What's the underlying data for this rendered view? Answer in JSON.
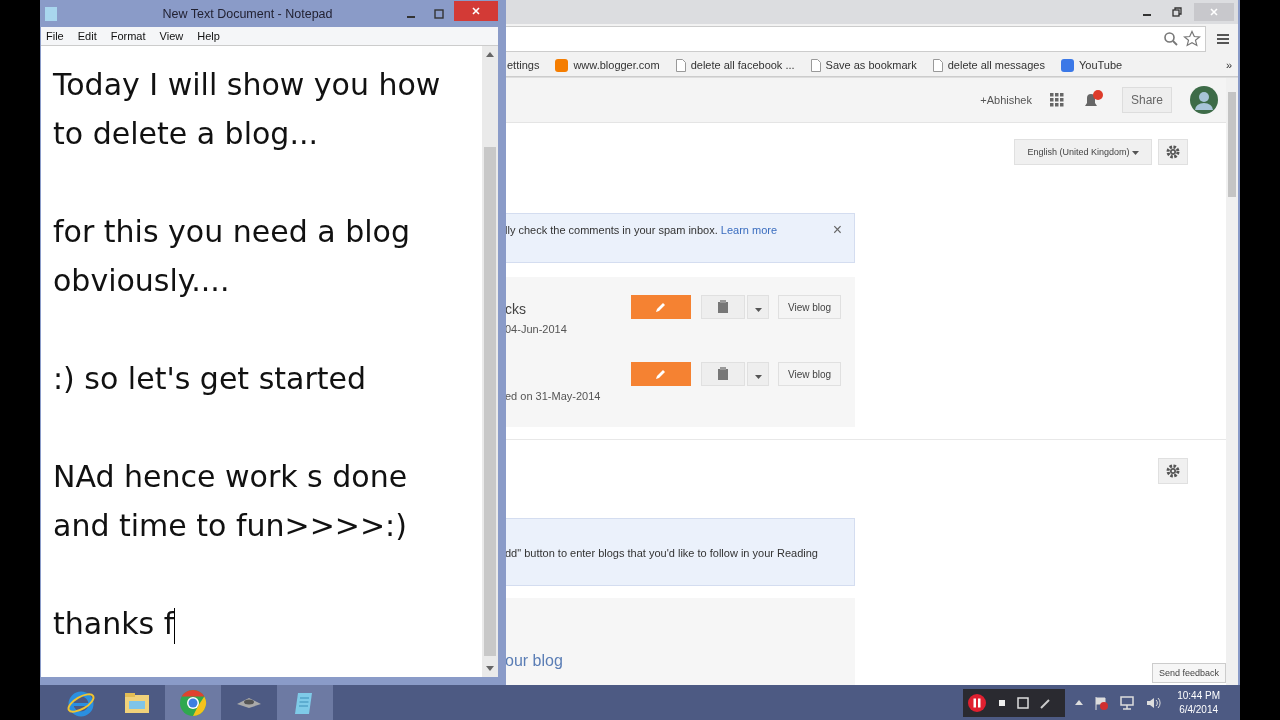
{
  "notepad": {
    "title": "New Text Document - Notepad",
    "menu": [
      "File",
      "Edit",
      "Format",
      "View",
      "Help"
    ],
    "paragraphs": [
      [
        "Today I will show you how",
        "to delete a blog..."
      ],
      [
        "for this you need a blog",
        "obviously...."
      ],
      [
        ":) so let's get started"
      ],
      [
        "NAd hence work s done",
        "and time to fun>>>>:)"
      ],
      [
        "thanks f"
      ]
    ]
  },
  "browser": {
    "bookmarks": [
      {
        "label": "ettings",
        "kind": "none"
      },
      {
        "label": "www.blogger.com",
        "kind": "blogger"
      },
      {
        "label": "delete all facebook ...",
        "kind": "page"
      },
      {
        "label": "Save as bookmark",
        "kind": "page"
      },
      {
        "label": "delete all messages",
        "kind": "page"
      },
      {
        "label": "YouTube",
        "kind": "google"
      }
    ],
    "bookmarks_more": "»",
    "header": {
      "user": "+Abhishek",
      "share": "Share"
    },
    "language": "English (United Kingdom)",
    "notice": {
      "text": "lly check the comments in your spam inbox.",
      "link": "Learn more",
      "close": "×"
    },
    "blogs": [
      {
        "title": "cks",
        "subtitle": "04-Jun-2014",
        "view": "View blog"
      },
      {
        "subtitle": "ed on 31-May-2014",
        "view": "View blog"
      }
    ],
    "reading_notice": "dd\" button to enter blogs that you'd like to follow in your Reading",
    "reading_heading": "our blog",
    "feedback": "Send feedback"
  },
  "taskbar": {
    "apps": [
      {
        "kind": "ie",
        "selected": false
      },
      {
        "kind": "folder",
        "selected": false
      },
      {
        "kind": "chrome",
        "selected": true
      },
      {
        "kind": "disc",
        "selected": false
      },
      {
        "kind": "notepad",
        "selected": true
      }
    ],
    "time": "10:44 PM",
    "date": "6/4/2014"
  }
}
